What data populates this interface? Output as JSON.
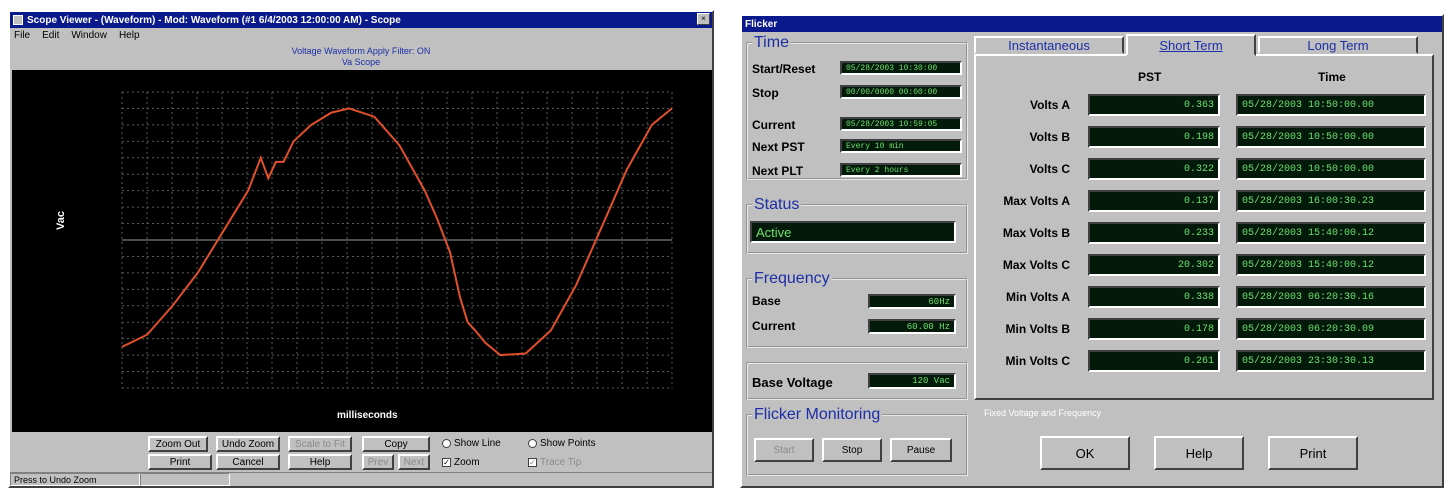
{
  "left": {
    "title": "Scope Viewer - (Waveform) - Mod: Waveform (#1 6/4/2003 12:00:00 AM) - Scope",
    "menu": [
      "File",
      "Edit",
      "Window",
      "Help"
    ],
    "chart_header_1": "Voltage Waveform Apply Filter: ON",
    "chart_header_2": "Va Scope",
    "ylabel": "Vac",
    "xlabel": "milliseconds",
    "buttons": {
      "zoom_out": "Zoom Out",
      "undo_zoom": "Undo Zoom",
      "scale_to_fit": "Scale to Fit",
      "copy": "Copy",
      "print": "Print",
      "cancel": "Cancel",
      "help": "Help",
      "prev": "Prev",
      "next": "Next"
    },
    "options": {
      "show_line": "Show Line",
      "show_points": "Show Points",
      "zoom": "Zoom",
      "trace_tip": "Trace Tip"
    },
    "status": "Press to Undo Zoom"
  },
  "chart_data": {
    "type": "line",
    "title": "Voltage Waveform Apply Filter: ON",
    "subtitle": "Va Scope",
    "xlabel": "milliseconds",
    "ylabel": "Vac",
    "ylim": [
      -180,
      180
    ],
    "grid": true,
    "color": "#e0502a",
    "x": [
      0,
      1,
      2,
      3,
      4,
      5,
      5.5,
      5.8,
      6.1,
      6.4,
      6.8,
      7.5,
      8.3,
      9,
      10,
      11,
      12,
      12.5,
      13,
      13.4,
      13.7,
      14,
      14.4,
      15,
      16,
      17,
      18,
      19,
      20,
      21,
      21.8
    ],
    "values": [
      -130,
      -115,
      -80,
      -40,
      10,
      60,
      100,
      75,
      95,
      95,
      120,
      140,
      155,
      160,
      150,
      115,
      60,
      25,
      -15,
      -70,
      -100,
      -110,
      -125,
      -140,
      -138,
      -110,
      -55,
      15,
      85,
      140,
      160
    ]
  },
  "right": {
    "title": "Flicker",
    "time_group": "Time",
    "start_label": "Start/Reset",
    "start_value": "05/28/2003 10:30:00",
    "stop_label": "Stop",
    "stop_value": "00/00/0000 00:00:00",
    "current_label": "Current",
    "current_value": "05/28/2003 10:59:05",
    "next_pst_label": "Next PST",
    "next_pst_value": "Every 10 min",
    "next_plt_label": "Next PLT",
    "next_plt_value": "Every 2 hours",
    "status_group": "Status",
    "status_value": "Active",
    "freq_group": "Frequency",
    "base_label": "Base",
    "base_value": "60Hz",
    "freq_current_label": "Current",
    "freq_current_value": "60.00 Hz",
    "base_voltage_label": "Base Voltage",
    "base_voltage_value": "120 Vac",
    "monitoring_group": "Flicker Monitoring",
    "start_btn": "Start",
    "stop_btn": "Stop",
    "pause_btn": "Pause",
    "tabs": [
      "Instantaneous",
      "Short Term",
      "Long Term"
    ],
    "col_pst": "PST",
    "col_time": "Time",
    "rows": [
      {
        "label": "Volts A",
        "pst": "0.363",
        "time": "05/28/2003 10:50:00.00"
      },
      {
        "label": "Volts B",
        "pst": "0.198",
        "time": "05/28/2003 10:50:00.00"
      },
      {
        "label": "Volts C",
        "pst": "0.322",
        "time": "05/28/2003 10:50:00.00"
      },
      {
        "label": "Max Volts A",
        "pst": "0.137",
        "time": "05/28/2003 16:00:30.23"
      },
      {
        "label": "Max Volts B",
        "pst": "0.233",
        "time": "05/28/2003 15:40:00.12"
      },
      {
        "label": "Max Volts C",
        "pst": "20.302",
        "time": "05/28/2003 15:40:00.12"
      },
      {
        "label": "Min Volts A",
        "pst": "0.338",
        "time": "05/28/2003 06:20:30.16"
      },
      {
        "label": "Min Volts B",
        "pst": "0.178",
        "time": "05/28/2003 06:20:30.09"
      },
      {
        "label": "Min Volts C",
        "pst": "0.261",
        "time": "05/28/2003 23:30:30.13"
      }
    ],
    "footnote": "Fixed Voltage and Frequency",
    "ok_btn": "OK",
    "help_btn": "Help",
    "print_btn": "Print"
  }
}
